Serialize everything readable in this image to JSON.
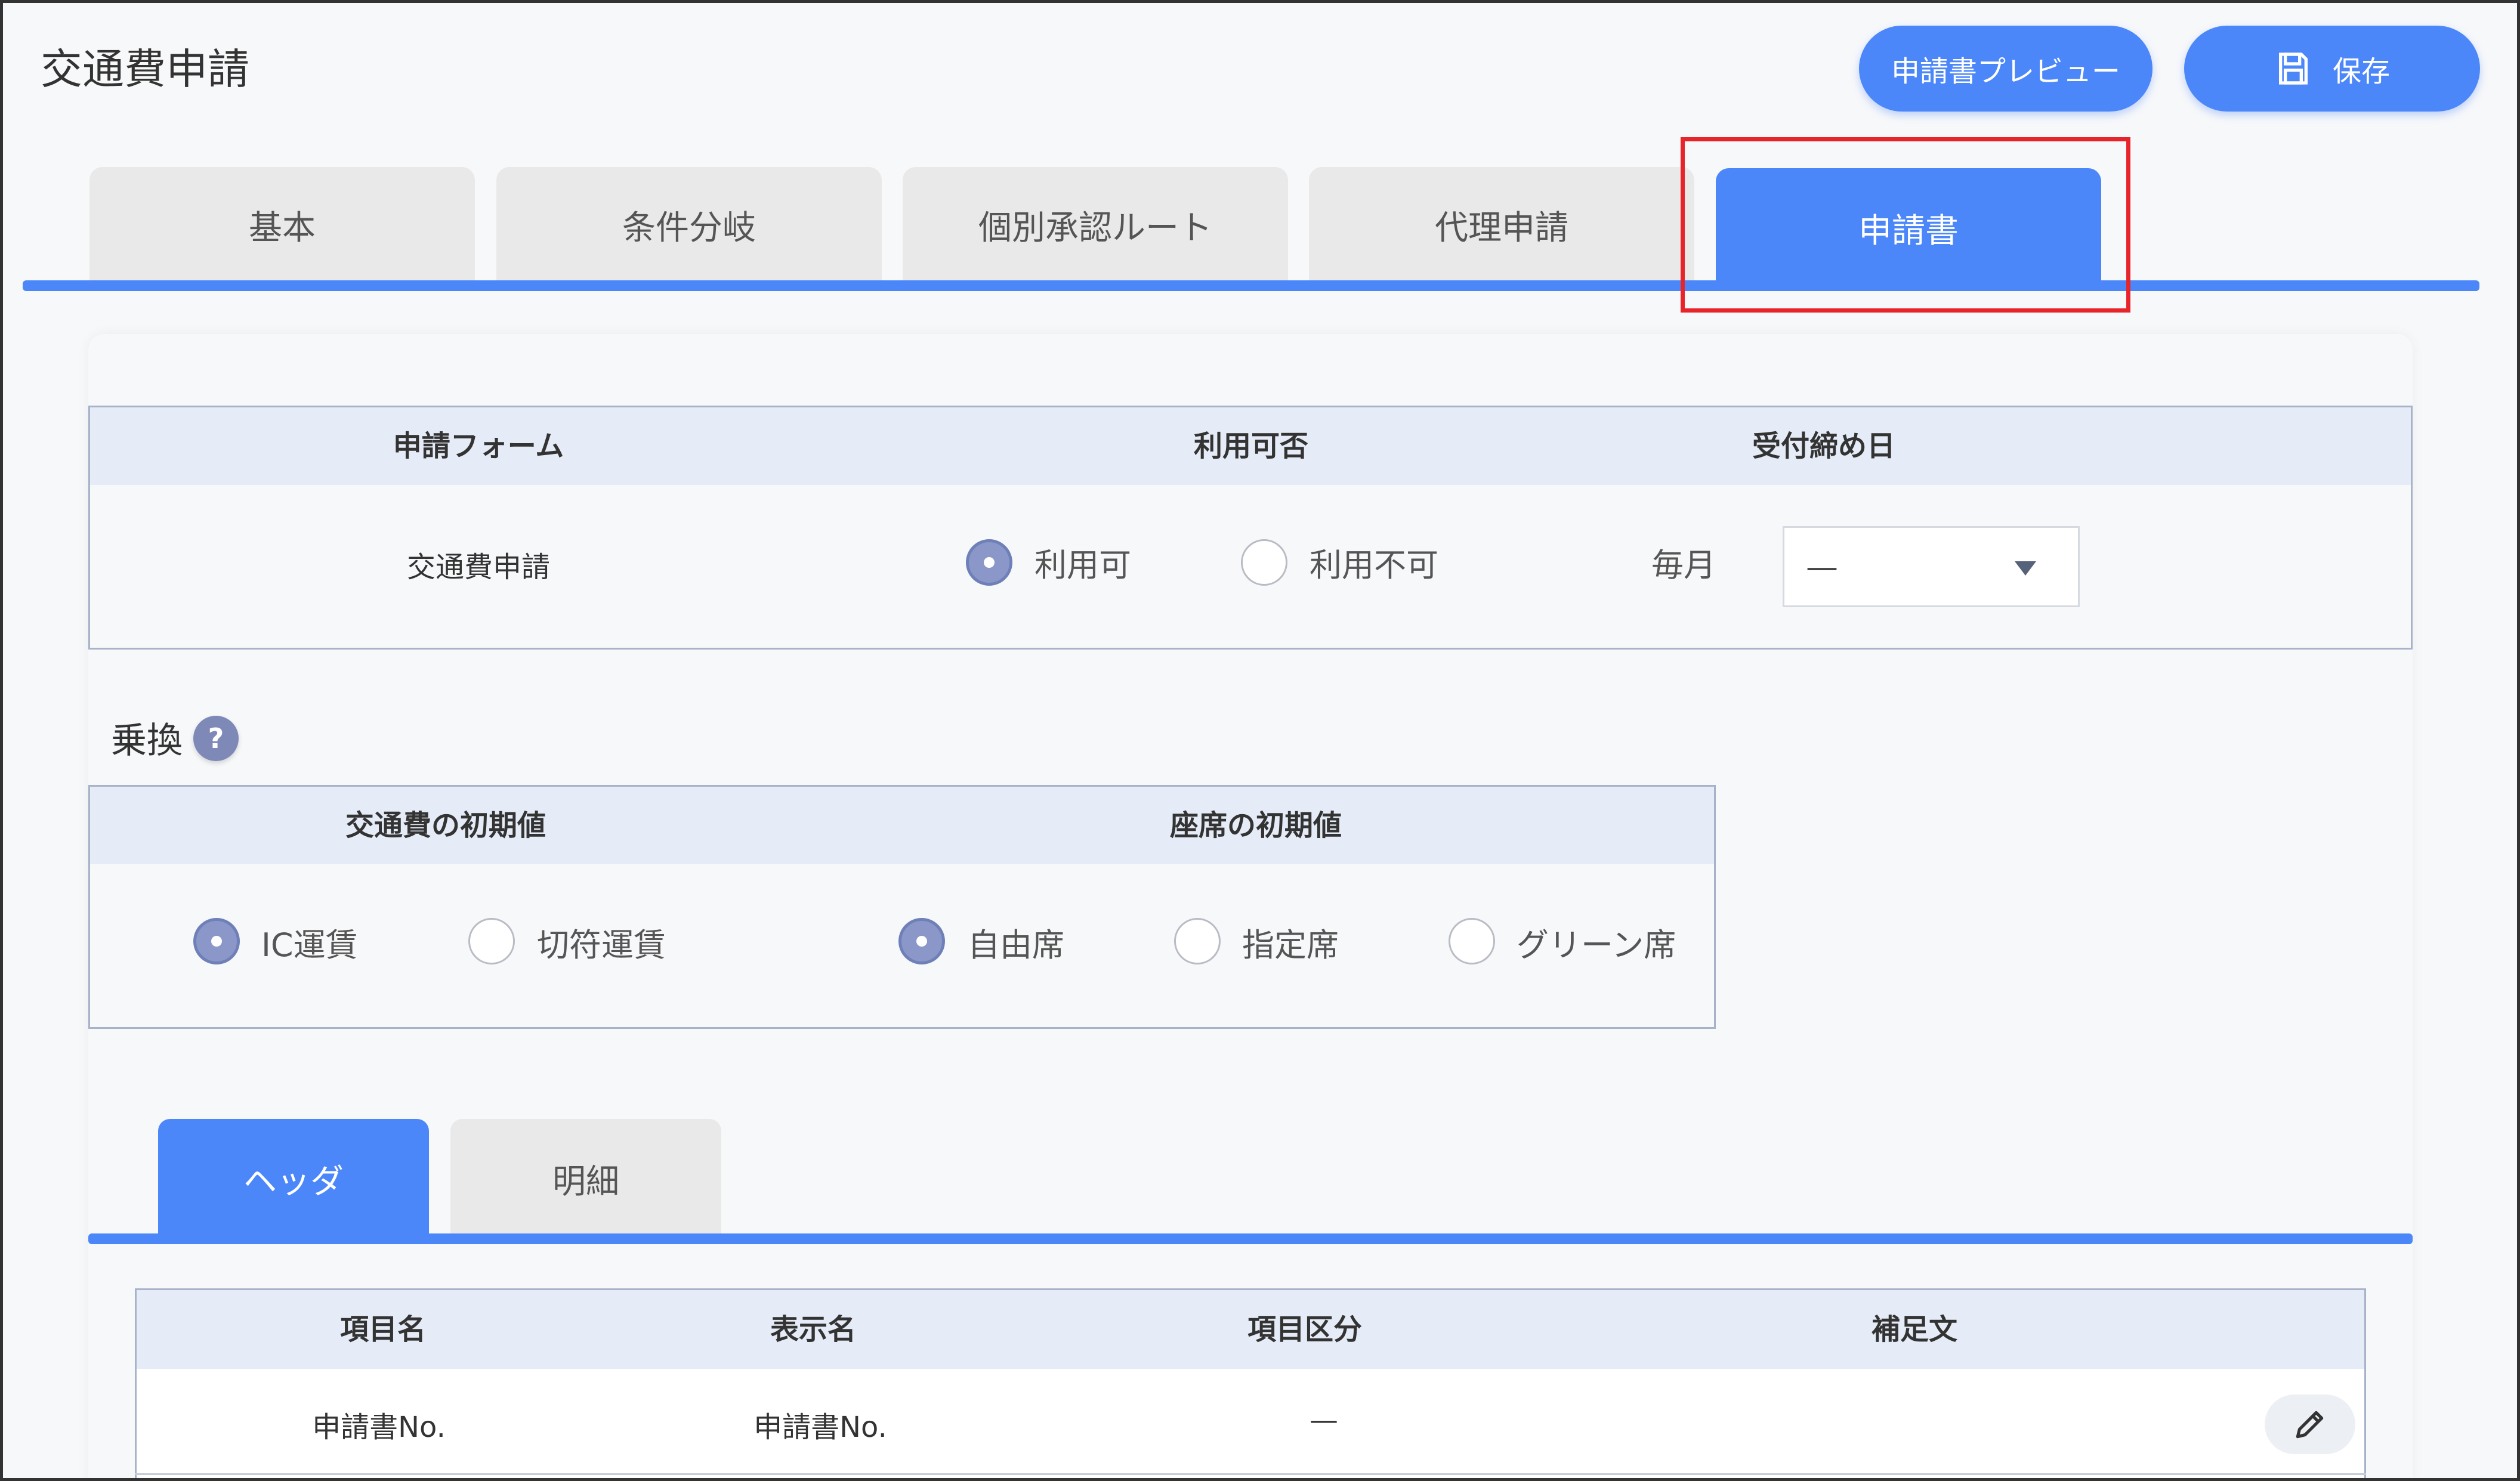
{
  "page": {
    "title": "交通費申請"
  },
  "toolbar": {
    "preview_label": "申請書プレビュー",
    "save_label": "保存"
  },
  "tabs": [
    {
      "label": "基本",
      "active": false
    },
    {
      "label": "条件分岐",
      "active": false
    },
    {
      "label": "個別承認ルート",
      "active": false
    },
    {
      "label": "代理申請",
      "active": false
    },
    {
      "label": "申請書",
      "active": true
    }
  ],
  "form_table": {
    "headers": {
      "form": "申請フォーム",
      "availability": "利用可否",
      "deadline": "受付締め日"
    },
    "row": {
      "form_name": "交通費申請",
      "options": [
        {
          "label": "利用可",
          "checked": true
        },
        {
          "label": "利用不可",
          "checked": false
        }
      ],
      "deadline_prefix": "毎月",
      "deadline_value": "—"
    }
  },
  "transfer": {
    "title": "乗換",
    "help_icon": "?",
    "headers": {
      "fare": "交通費の初期値",
      "seat": "座席の初期値"
    },
    "fare_options": [
      {
        "label": "IC運賃",
        "checked": true
      },
      {
        "label": "切符運賃",
        "checked": false
      }
    ],
    "seat_options": [
      {
        "label": "自由席",
        "checked": true
      },
      {
        "label": "指定席",
        "checked": false
      },
      {
        "label": "グリーン席",
        "checked": false
      }
    ]
  },
  "subtabs": [
    {
      "label": "ヘッダ",
      "active": true
    },
    {
      "label": "明細",
      "active": false
    }
  ],
  "items_table": {
    "headers": {
      "item_name": "項目名",
      "display_name": "表示名",
      "category": "項目区分",
      "note": "補足文"
    },
    "rows": [
      {
        "item_name": "申請書No.",
        "display_name": "申請書No.",
        "category": "—",
        "note": ""
      }
    ]
  },
  "colors": {
    "accent": "#4c87fa",
    "highlight": "#e8242b",
    "radio": "#8a97c8"
  }
}
